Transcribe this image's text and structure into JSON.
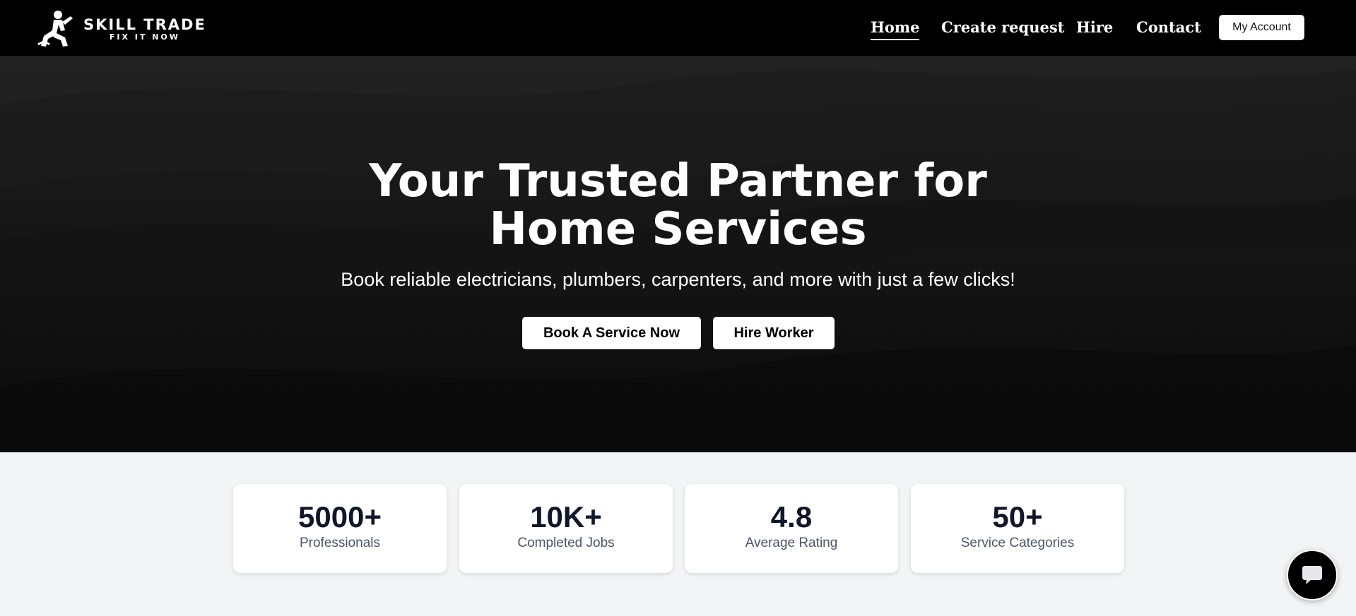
{
  "header": {
    "logo": {
      "title": "SKILL TRADE",
      "subtitle": "FIX IT NOW",
      "icon": "worker-kneeling-icon"
    },
    "nav": [
      {
        "label": "Home",
        "active": true
      },
      {
        "label": "Create request",
        "active": false
      },
      {
        "label": "Hire",
        "active": false
      },
      {
        "label": "Contact",
        "active": false
      }
    ],
    "account_button": "My Account"
  },
  "hero": {
    "title_line1": "Your Trusted Partner for",
    "title_line2": "Home Services",
    "subtitle": "Book reliable electricians, plumbers, carpenters, and more with just a few clicks!",
    "primary_button": "Book A Service Now",
    "secondary_button": "Hire Worker"
  },
  "stats": [
    {
      "value": "5000+",
      "label": "Professionals"
    },
    {
      "value": "10K+",
      "label": "Completed Jobs"
    },
    {
      "value": "4.8",
      "label": "Average Rating"
    },
    {
      "value": "50+",
      "label": "Service Categories"
    }
  ],
  "chat": {
    "icon": "chat-bubble-icon"
  },
  "colors": {
    "header_bg": "#000000",
    "hero_bg": "#161616",
    "stats_bg": "#f3f4f6",
    "card_bg": "#ffffff",
    "stat_value": "#0f172a",
    "stat_label": "#4b5563"
  }
}
